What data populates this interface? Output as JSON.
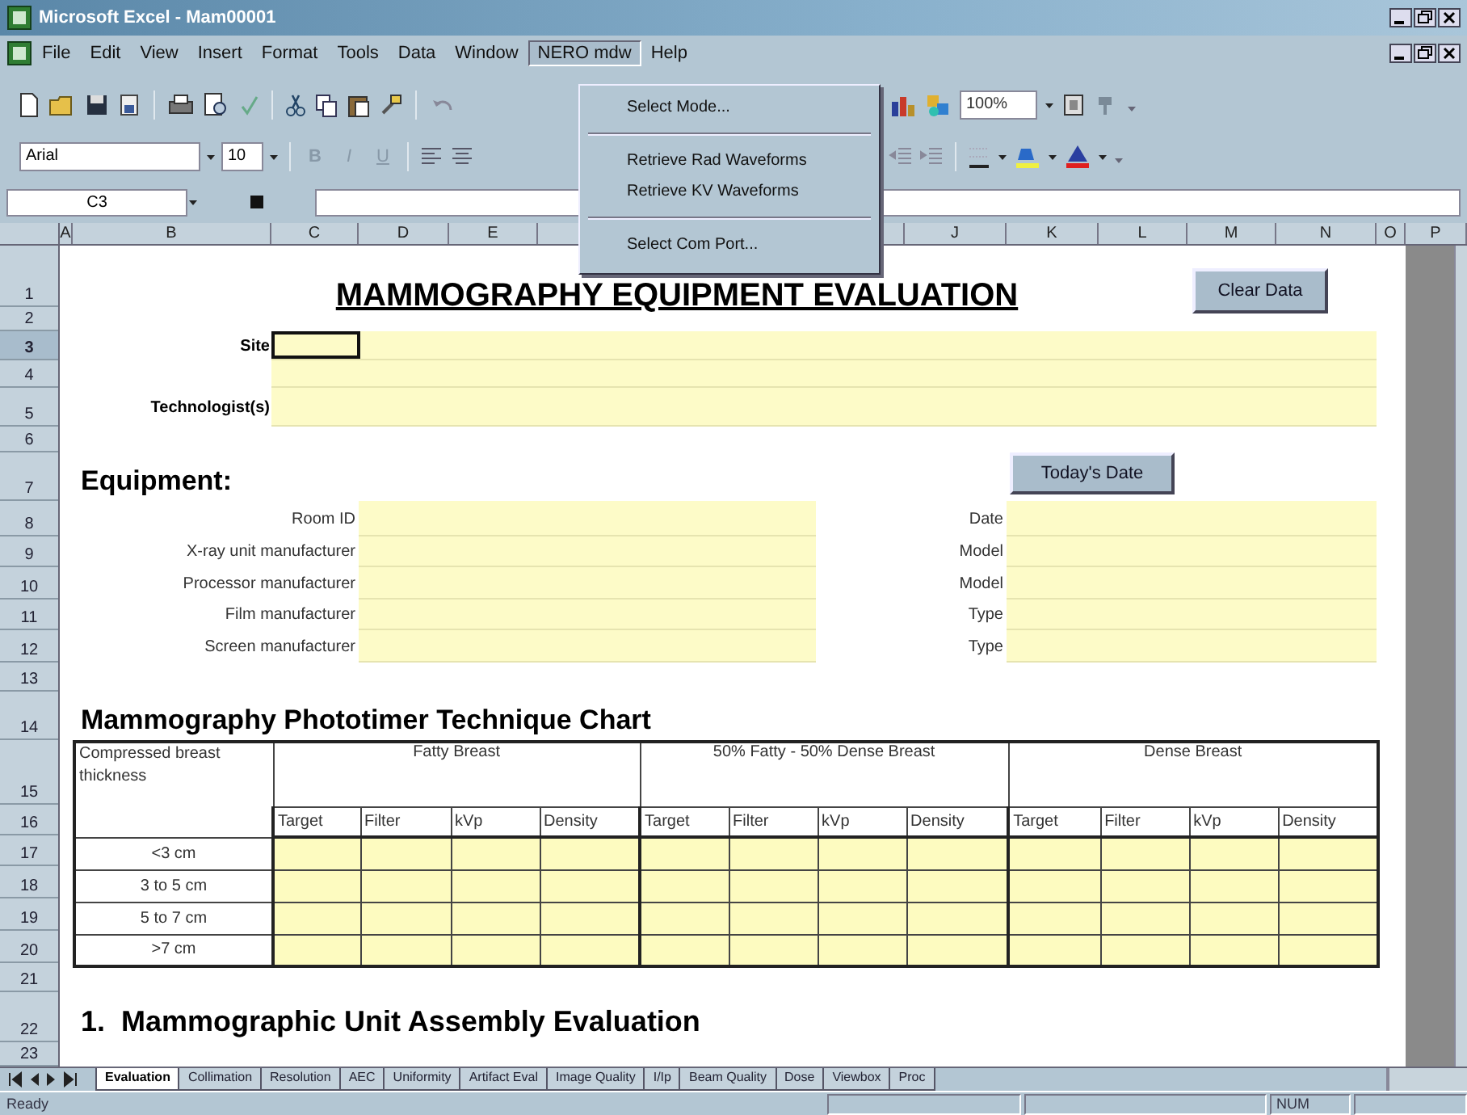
{
  "window": {
    "title": "Microsoft Excel - Mam00001"
  },
  "menu_bar": [
    {
      "label": "File",
      "selected": false
    },
    {
      "label": "Edit",
      "selected": false
    },
    {
      "label": "View",
      "selected": false
    },
    {
      "label": "Insert",
      "selected": false
    },
    {
      "label": "Format",
      "selected": false
    },
    {
      "label": "Tools",
      "selected": false
    },
    {
      "label": "Data",
      "selected": false
    },
    {
      "label": "Window",
      "selected": false
    },
    {
      "label": "NERO mdw",
      "selected": true
    },
    {
      "label": "Help",
      "selected": false
    }
  ],
  "open_menu": {
    "items": [
      {
        "kind": "item",
        "label": "Select Mode..."
      },
      {
        "kind": "separator"
      },
      {
        "kind": "item",
        "label": "Retrieve Rad Waveforms"
      },
      {
        "kind": "item",
        "label": "Retrieve KV Waveforms"
      },
      {
        "kind": "separator"
      },
      {
        "kind": "item",
        "label": "Select Com Port..."
      }
    ]
  },
  "toolbar": {
    "zoom": "100%"
  },
  "formatting": {
    "font": "Arial",
    "size": "10",
    "style_buttons": [
      "B",
      "I",
      "U"
    ]
  },
  "formula_bar": {
    "name_box": "C3"
  },
  "column_headers": [
    "A",
    "B",
    "C",
    "D",
    "E",
    "J",
    "K",
    "L",
    "M",
    "N",
    "O",
    "P"
  ],
  "row_headers": [
    "1",
    "2",
    "3",
    "4",
    "5",
    "6",
    "7",
    "8",
    "9",
    "10",
    "11",
    "12",
    "13",
    "14",
    "15",
    "16",
    "17",
    "18",
    "19",
    "20",
    "21",
    "22",
    "23"
  ],
  "sheet": {
    "title": "MAMMOGRAPHY EQUIPMENT EVALUATION",
    "clear_button": "Clear Data",
    "site_label": "Site",
    "technologist_label": "Technologist(s)",
    "equipment": {
      "heading": "Equipment:",
      "date_button": "Today's Date",
      "rows": [
        {
          "label": "Room ID",
          "right_label": "Date"
        },
        {
          "label": "X-ray unit manufacturer",
          "right_label": "Model"
        },
        {
          "label": "Processor manufacturer",
          "right_label": "Model"
        },
        {
          "label": "Film manufacturer",
          "right_label": "Type"
        },
        {
          "label": "Screen manufacturer",
          "right_label": "Type"
        }
      ]
    },
    "chart": {
      "heading": "Mammography Phototimer Technique Chart",
      "corner": "Compressed breast thickness",
      "groups": [
        {
          "label": "Fatty Breast",
          "columns": [
            "Target",
            "Filter",
            "kVp",
            "Density"
          ]
        },
        {
          "label": "50% Fatty - 50% Dense Breast",
          "columns": [
            "Target",
            "Filter",
            "kVp",
            "Density"
          ]
        },
        {
          "label": "Dense Breast",
          "columns": [
            "Target",
            "Filter",
            "kVp",
            "Density"
          ]
        }
      ],
      "rows": [
        "<3 cm",
        "3 to 5 cm",
        "5 to 7 cm",
        ">7 cm"
      ]
    },
    "section_heading": "1.  Mammographic Unit Assembly Evaluation"
  },
  "sheet_tabs": [
    {
      "label": "Evaluation",
      "selected": true
    },
    {
      "label": "Collimation",
      "selected": false
    },
    {
      "label": "Resolution",
      "selected": false
    },
    {
      "label": "AEC",
      "selected": false
    },
    {
      "label": "Uniformity",
      "selected": false
    },
    {
      "label": "Artifact Eval",
      "selected": false
    },
    {
      "label": "Image Quality",
      "selected": false
    },
    {
      "label": "I/Ip",
      "selected": false
    },
    {
      "label": "Beam Quality",
      "selected": false
    },
    {
      "label": "Dose",
      "selected": false
    },
    {
      "label": "Viewbox",
      "selected": false
    },
    {
      "label": "Proc",
      "selected": false
    }
  ],
  "status_bar": {
    "mode": "Ready",
    "indicator": "NUM"
  }
}
